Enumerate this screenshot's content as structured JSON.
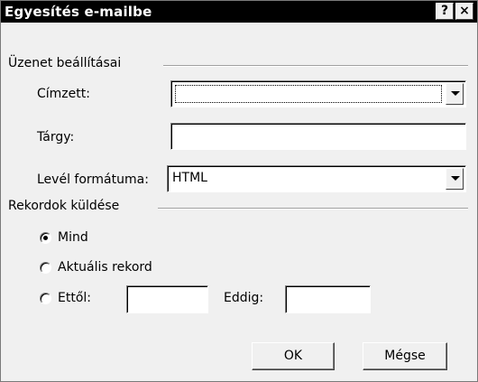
{
  "dialog": {
    "title": "Egyesítés e-mailbe",
    "help_label": "?",
    "close_label": "×"
  },
  "message_settings": {
    "group_label": "Üzenet beállításai",
    "to_label": "Címzett:",
    "to_value": "",
    "subject_label": "Tárgy:",
    "subject_value": "",
    "format_label": "Levél formátuma:",
    "format_value": "HTML"
  },
  "send_records": {
    "group_label": "Rekordok küldése",
    "options": [
      {
        "label": "Mind",
        "checked": true
      },
      {
        "label": "Aktuális rekord",
        "checked": false
      },
      {
        "label": "Ettől:",
        "checked": false
      }
    ],
    "from_value": "",
    "to_label": "Eddig:",
    "to_value": ""
  },
  "buttons": {
    "ok_label": "OK",
    "cancel_label": "Mégse"
  }
}
